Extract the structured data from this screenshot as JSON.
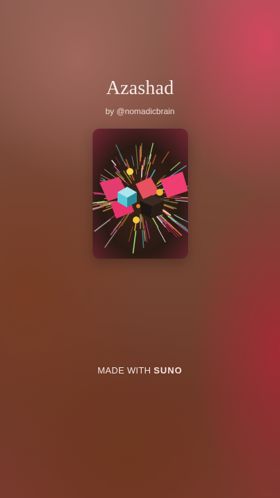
{
  "song": {
    "title": "Azashad",
    "byline": "by @nomadicbrain"
  },
  "footer": {
    "made_with": "MADE WITH",
    "brand": "SUNO"
  },
  "colors": {
    "title_text": "#f4ece8",
    "accent_pink": "#e8336b",
    "accent_yellow": "#f5c93c",
    "accent_cyan": "#58c9d6"
  }
}
